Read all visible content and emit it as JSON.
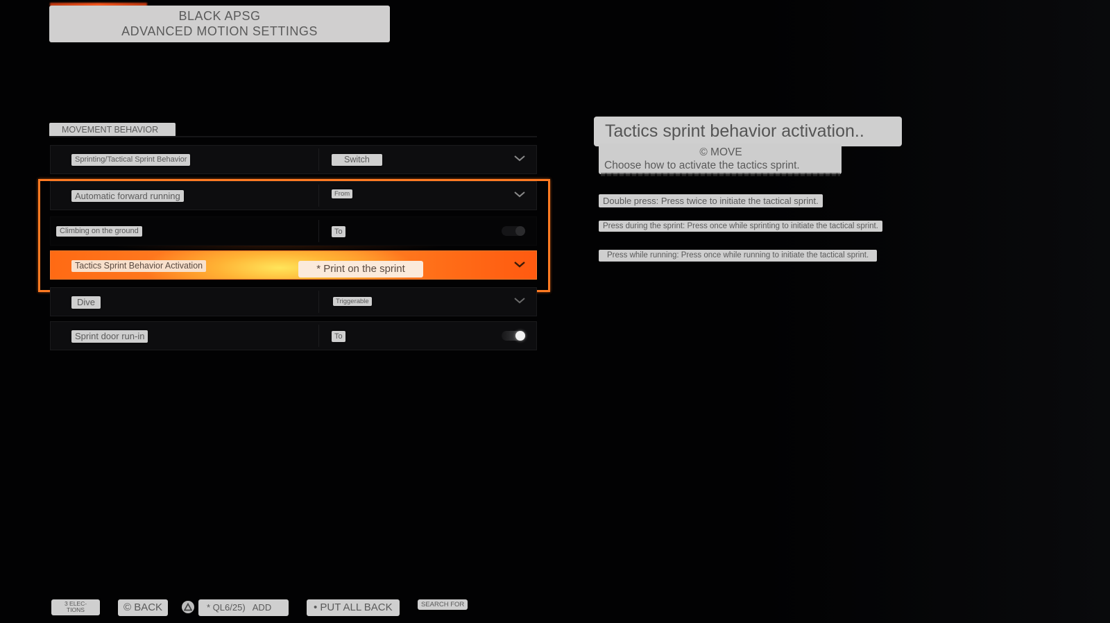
{
  "header": {
    "line1": "BLACK APSG",
    "line2": "ADVANCED MOTION SETTINGS"
  },
  "section": {
    "title": "MOVEMENT BEHAVIOR"
  },
  "settings": [
    {
      "name": "Sprinting/Tactical Sprint Behavior",
      "value": "Switch",
      "control": "dropdown"
    },
    {
      "name": "Automatic forward running",
      "value": "From",
      "control": "dropdown"
    },
    {
      "name": "Climbing on the ground",
      "value": "To",
      "control": "toggle",
      "toggle_state": "off"
    },
    {
      "name": "Tactics Sprint Behavior Activation",
      "value": "* Print on the sprint",
      "control": "dropdown",
      "selected": true
    },
    {
      "name": "Dive",
      "value": "Triggerable",
      "control": "dropdown"
    },
    {
      "name": "Sprint door run-in",
      "value": "To",
      "control": "toggle",
      "toggle_state": "on"
    }
  ],
  "description": {
    "title": "Tactics sprint behavior activation..",
    "move_label": "© MOVE",
    "subtitle": "Choose how to activate the tactics sprint.",
    "options": [
      "Double press: Press twice to initiate the tactical sprint.",
      "Press during the sprint: Press once while sprinting to initiate the tactical sprint.",
      "Press while running: Press once while running to initiate the tactical sprint."
    ]
  },
  "footer": {
    "selections": "3 ELEC-\nTIONS",
    "back": "© BACK",
    "add": "* QL6/25)   ADD",
    "put_all_back": "• PUT ALL BACK",
    "search": "SEARCH FOR"
  },
  "colors": {
    "accent": "#ff7a22",
    "label_bg": "#cfcfcf",
    "background": "#020203"
  }
}
